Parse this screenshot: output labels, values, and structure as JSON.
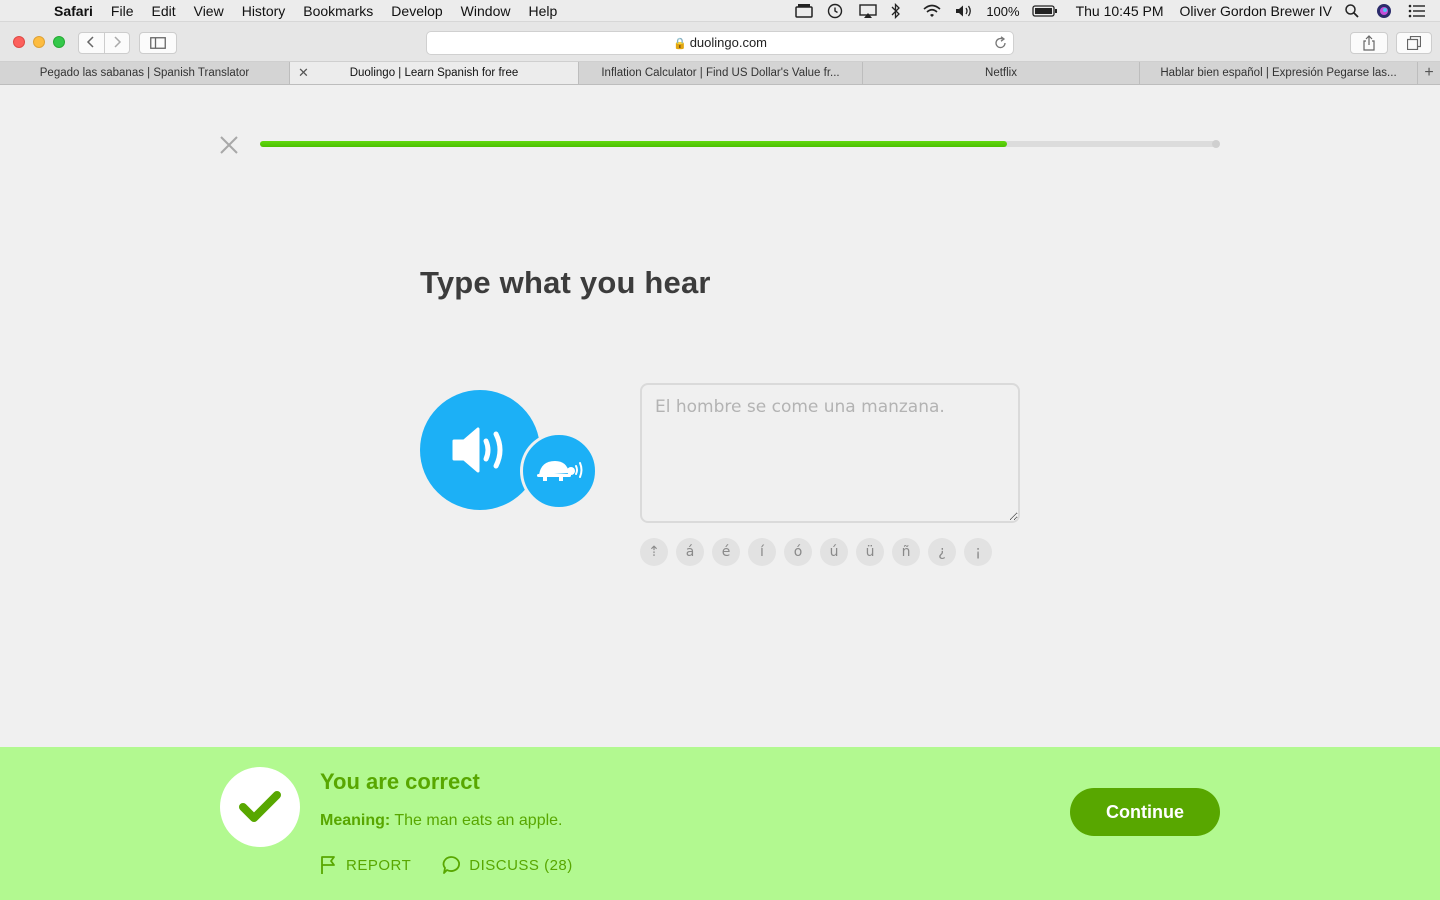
{
  "menubar": {
    "app": "Safari",
    "items": [
      "File",
      "Edit",
      "View",
      "History",
      "Bookmarks",
      "Develop",
      "Window",
      "Help"
    ],
    "battery": "100%",
    "clock": "Thu 10:45 PM",
    "user": "Oliver Gordon Brewer IV"
  },
  "browser": {
    "url": "duolingo.com",
    "tabs": [
      {
        "title": "Pegado las sabanas | Spanish Translator"
      },
      {
        "title": "Duolingo | Learn Spanish for free",
        "active": true
      },
      {
        "title": "Inflation Calculator | Find US Dollar's Value fr..."
      },
      {
        "title": "Netflix"
      },
      {
        "title": "Hablar bien español | Expresión Pegarse las..."
      }
    ]
  },
  "lesson": {
    "progress": 0.78,
    "title": "Type what you hear",
    "answer_text": "El hombre se come una manzana.",
    "special_keys": [
      "⇡",
      "á",
      "é",
      "í",
      "ó",
      "ú",
      "ü",
      "ñ",
      "¿",
      "¡"
    ]
  },
  "feedback": {
    "title": "You are correct",
    "meaning_label": "Meaning:",
    "meaning_text": "The man eats an apple.",
    "report_label": "REPORT",
    "discuss_label": "DISCUSS (28)",
    "continue_label": "Continue"
  },
  "colors": {
    "accent_blue": "#1cb0f6",
    "success_green": "#58a700",
    "progress_green": "#58cc02",
    "feedback_bg": "#b2f990"
  }
}
